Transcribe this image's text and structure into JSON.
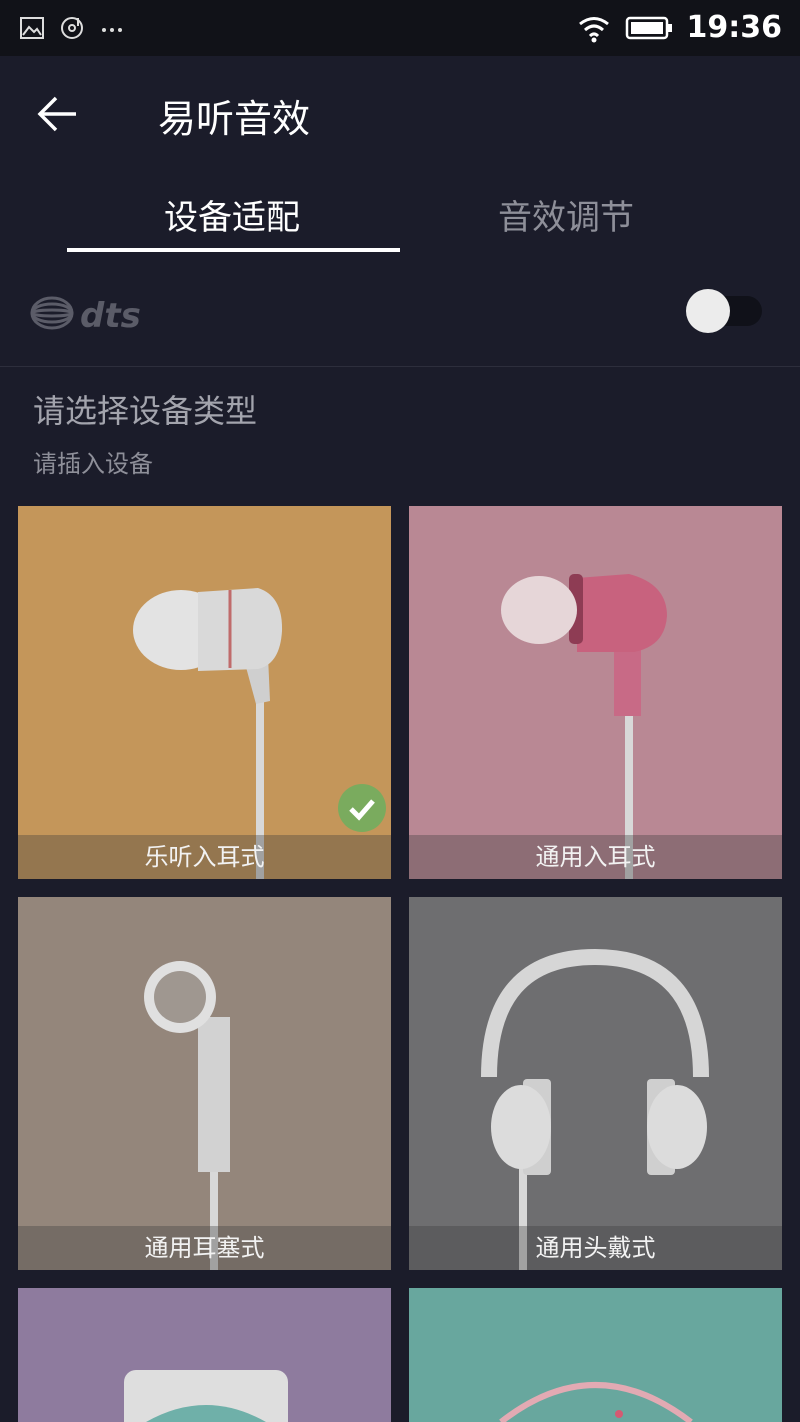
{
  "status_bar": {
    "left_icons": [
      "image-icon",
      "music-disc-icon",
      "more-dots-icon"
    ],
    "right_icons": [
      "wifi-icon",
      "battery-icon"
    ],
    "time": "19:36"
  },
  "app_bar": {
    "back_icon": "arrow-left-icon",
    "title": "易听音效"
  },
  "tabs": [
    {
      "label": "设备适配",
      "active": true
    },
    {
      "label": "音效调节",
      "active": false
    }
  ],
  "dts": {
    "logo_text": "dts",
    "enabled": false
  },
  "section": {
    "title": "请选择设备类型",
    "subtitle": "请插入设备"
  },
  "devices": [
    {
      "label": "乐听入耳式",
      "color": "#c4965a",
      "selected": true
    },
    {
      "label": "通用入耳式",
      "color": "#b98894",
      "selected": false
    },
    {
      "label": "通用耳塞式",
      "color": "#94867b",
      "selected": false
    },
    {
      "label": "通用头戴式",
      "color": "#6e6e70",
      "selected": false
    },
    {
      "label": "",
      "color": "#8e7b9e",
      "selected": false
    },
    {
      "label": "",
      "color": "#68a79e",
      "selected": false
    }
  ]
}
